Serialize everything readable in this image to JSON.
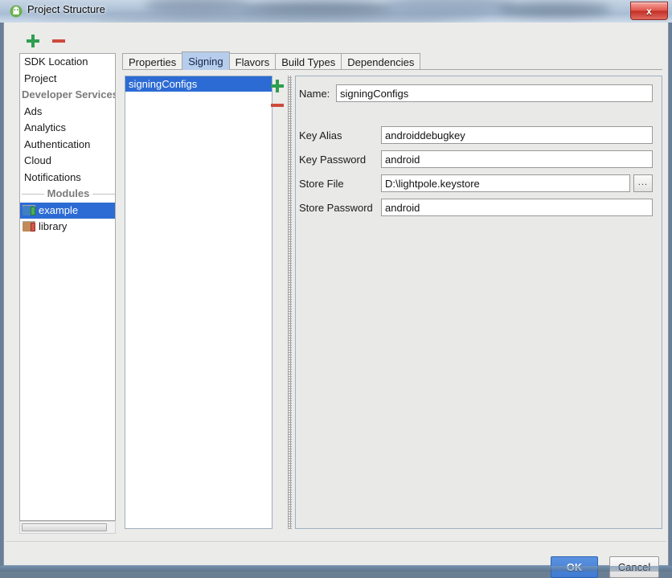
{
  "window": {
    "title": "Project Structure",
    "app_icon": "android-studio-icon",
    "close_label": "x"
  },
  "toolbar": {
    "add_label": "+",
    "remove_label": "−"
  },
  "sidebar": {
    "items": [
      {
        "label": "SDK Location",
        "type": "item",
        "selected": false
      },
      {
        "label": "Project",
        "type": "item",
        "selected": false
      },
      {
        "label": "Developer Services",
        "type": "group",
        "selected": false
      },
      {
        "label": "Ads",
        "type": "item",
        "selected": false
      },
      {
        "label": "Analytics",
        "type": "item",
        "selected": false
      },
      {
        "label": "Authentication",
        "type": "item",
        "selected": false
      },
      {
        "label": "Cloud",
        "type": "item",
        "selected": false
      },
      {
        "label": "Notifications",
        "type": "item",
        "selected": false
      },
      {
        "label": "Modules",
        "type": "group",
        "selected": false
      },
      {
        "label": "example",
        "type": "module",
        "icon": "module-app-icon",
        "selected": true
      },
      {
        "label": "library",
        "type": "module",
        "icon": "module-library-icon",
        "selected": false
      }
    ]
  },
  "tabs": [
    {
      "label": "Properties",
      "active": false
    },
    {
      "label": "Signing",
      "active": true
    },
    {
      "label": "Flavors",
      "active": false
    },
    {
      "label": "Build Types",
      "active": false
    },
    {
      "label": "Dependencies",
      "active": false
    }
  ],
  "signing_configs": {
    "items": [
      {
        "label": "signingConfigs",
        "selected": true
      }
    ],
    "add_label": "+",
    "remove_label": "−"
  },
  "detail": {
    "name": {
      "label": "Name:",
      "value": "signingConfigs"
    },
    "key_alias": {
      "label": "Key Alias",
      "value": "androiddebugkey"
    },
    "key_password": {
      "label": "Key Password",
      "value": "android"
    },
    "store_file": {
      "label": "Store File",
      "value": "D:\\lightpole.keystore",
      "browse_label": "..."
    },
    "store_password": {
      "label": "Store Password",
      "value": "android"
    }
  },
  "footer": {
    "ok_label": "OK",
    "cancel_label": "Cancel"
  },
  "colors": {
    "selection_blue": "#2d6bd4",
    "tab_active_blue": "#b6cdec",
    "accent_green": "#2f9e4f",
    "accent_red": "#cc4b3c",
    "ok_blue": "#3f7ad2"
  }
}
